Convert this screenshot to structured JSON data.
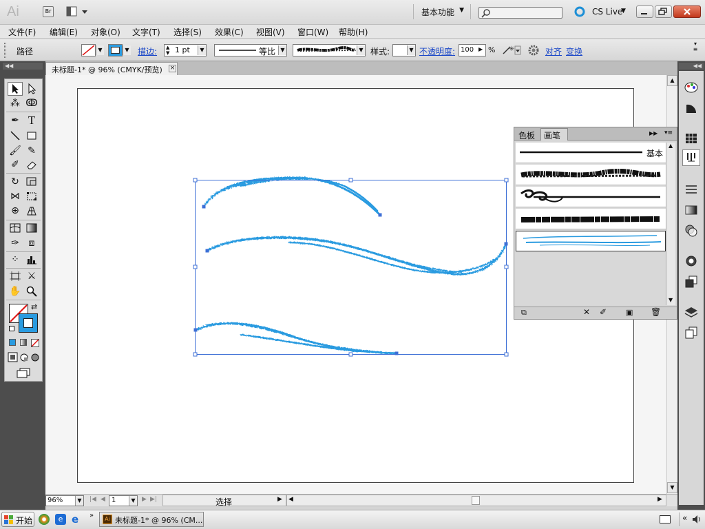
{
  "app": {
    "logo": "Ai",
    "bridge": "Br",
    "workspace": "基本功能",
    "cs_live": "CS Live",
    "search_placeholder": ""
  },
  "menu": [
    "文件(F)",
    "编辑(E)",
    "对象(O)",
    "文字(T)",
    "选择(S)",
    "效果(C)",
    "视图(V)",
    "窗口(W)",
    "帮助(H)"
  ],
  "control": {
    "label": "路径",
    "stroke_link": "描边:",
    "stroke_weight": "1 pt",
    "profile": "等比",
    "style_label": "样式:",
    "opacity_link": "不透明度:",
    "opacity": "100",
    "percent": "%",
    "align_link": "对齐",
    "transform_link": "变换"
  },
  "document": {
    "tab": "未标题-1* @ 96% (CMYK/预览)"
  },
  "status": {
    "zoom": "96%",
    "page": "1",
    "mode": "选择"
  },
  "brush_panel": {
    "tabs": [
      "色板",
      "画笔"
    ],
    "active_tab": "画笔",
    "brushes": [
      "基本",
      "",
      "",
      "",
      ""
    ]
  },
  "taskbar": {
    "start": "开始",
    "task": "未标题-1* @ 96% (CM..."
  },
  "colors": {
    "accent": "#2a9be0",
    "dock": "#4d4d4d",
    "link": "#1a47c8"
  }
}
